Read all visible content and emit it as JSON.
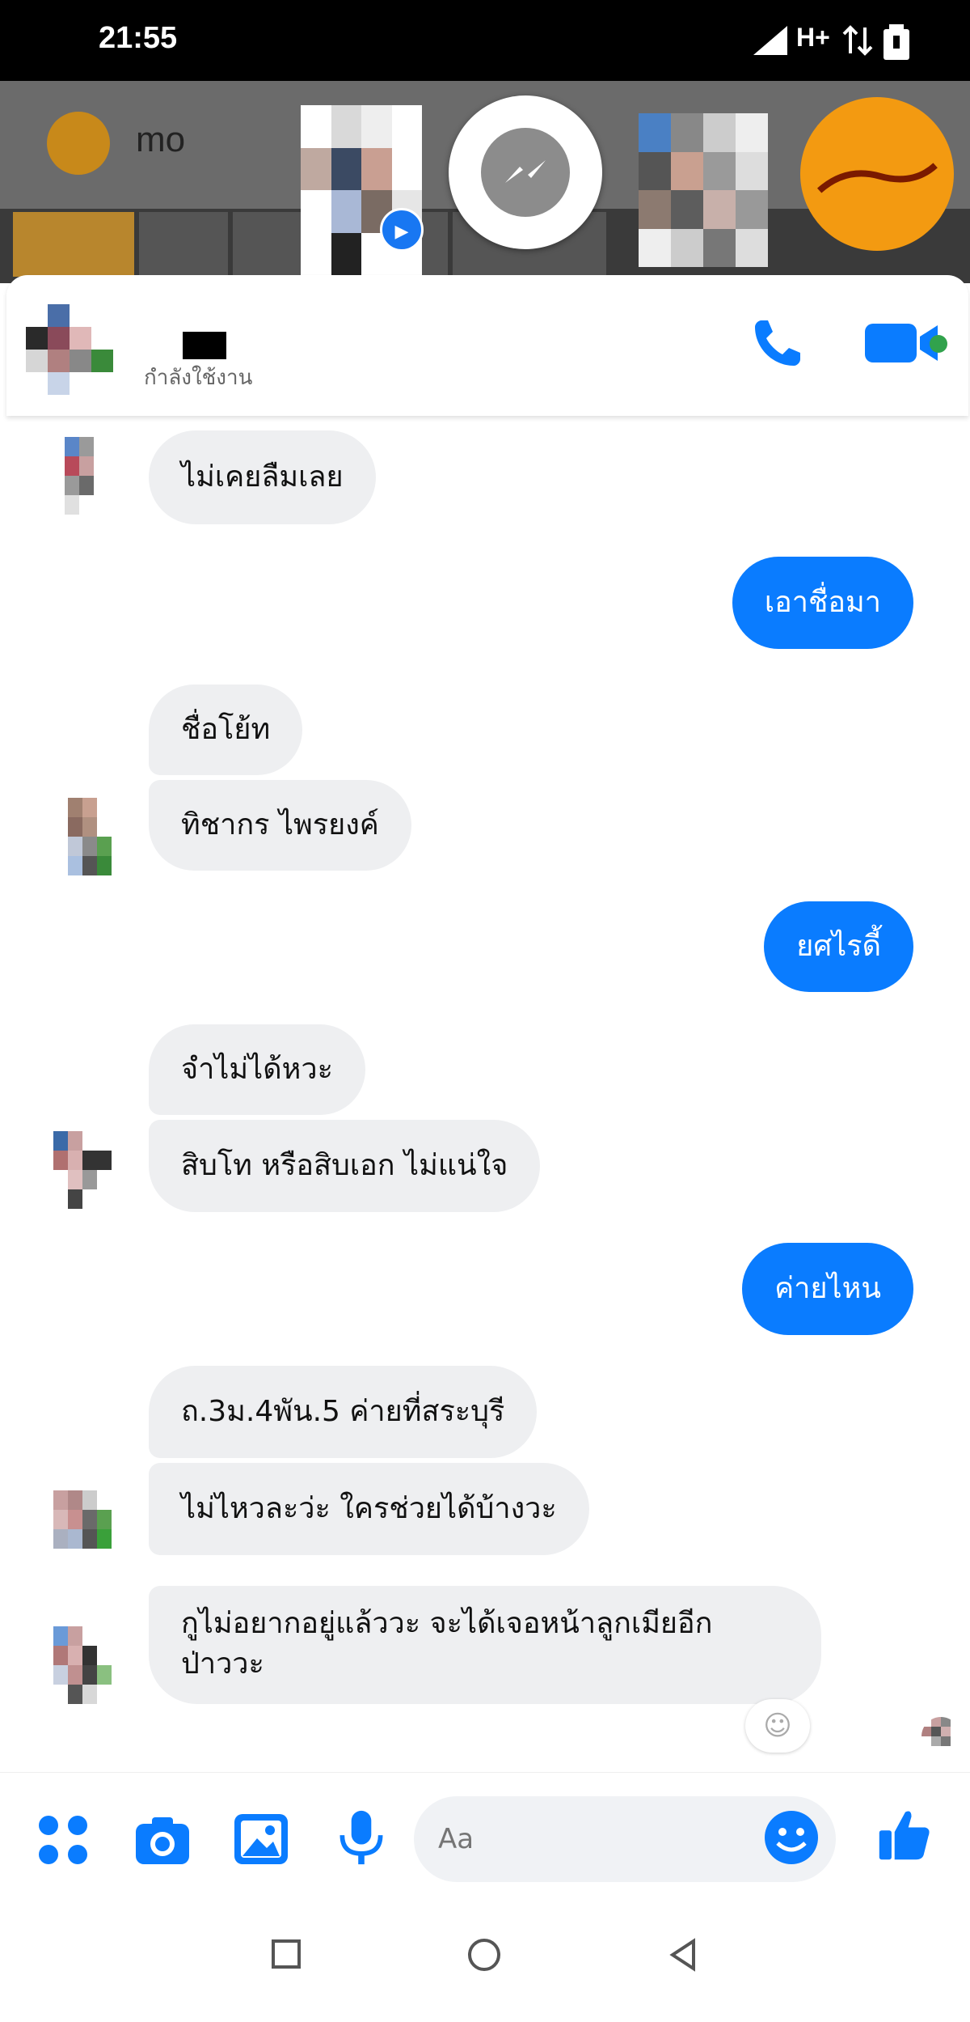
{
  "status_bar": {
    "time": "21:55",
    "network": "H+"
  },
  "background_app": {
    "partial_title": "mo"
  },
  "header": {
    "contact_status": "กำลังใช้งาน"
  },
  "messages": [
    {
      "side": "received",
      "text": "ไม่เคยลืมเลย"
    },
    {
      "side": "sent",
      "text": "เอาชื่อมา"
    },
    {
      "side": "received",
      "text": "ชื่อโย้ท"
    },
    {
      "side": "received",
      "text": "ทิชากร ไพรยงค์"
    },
    {
      "side": "sent",
      "text": "ยศไรดี้"
    },
    {
      "side": "received",
      "text": "จำไม่ได้หวะ"
    },
    {
      "side": "received",
      "text": "สิบโท หรือสิบเอก ไม่แน่ใจ"
    },
    {
      "side": "sent",
      "text": "ค่ายไหน"
    },
    {
      "side": "received",
      "text": "ถ.3ม.4พัน.5 ค่ายที่สระบุรี"
    },
    {
      "side": "received",
      "text": "ไม่ไหวละว่ะ ใครช่วยได้บ้างวะ"
    },
    {
      "side": "received",
      "text": "กูไม่อยากอยู่แล้ววะ จะได้เจอหน้าลูกเมียอีก\nป่าววะ"
    }
  ],
  "composer": {
    "placeholder": "Aa"
  },
  "icons": {
    "menu": "grid-dots-icon",
    "camera": "camera-icon",
    "gallery": "image-icon",
    "mic": "microphone-icon",
    "emoji": "smiley-icon",
    "like": "thumbs-up-icon",
    "call": "phone-icon",
    "video": "video-camera-icon"
  },
  "colors": {
    "accent": "#0a7cff",
    "received_bubble": "#eeeff1",
    "online": "#31a24c"
  }
}
